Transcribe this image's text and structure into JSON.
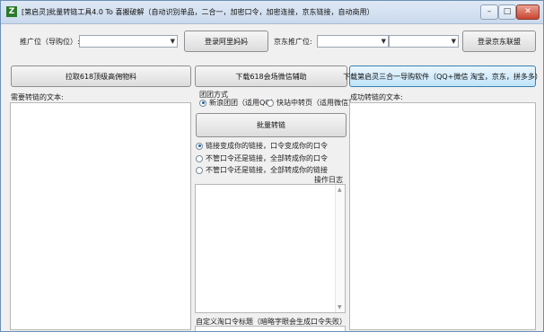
{
  "window": {
    "title": "[第启灵]批量转链工具4.0 To 喜搬破解（自动识别单品，二合一，加密口令，加密连接，京东链接，自动商用）",
    "min_glyph": "–",
    "max_glyph": "□",
    "close_glyph": "✕"
  },
  "top": {
    "promo_label": "推广位（导购位）:",
    "promo_value": "",
    "login_alimama": "登录阿里妈妈",
    "jd_promo_label": "京东推广位:",
    "jd_value1": "",
    "jd_value2": "",
    "login_jd": "登录京东联盟"
  },
  "actions": {
    "pull_button": "拉取618顶级高佣物料",
    "download_assist": "下载618会场微信辅助",
    "download_three": "下载第启灵三合一导购软件（QQ+微信 淘宝，京东，拼多多）"
  },
  "left": {
    "label": "需要转链的文本:"
  },
  "middle": {
    "method_label": "团团方式",
    "radio1": "新浪团团（适用QQ）",
    "radio2": "快站中转页（适用微信）",
    "batch_button": "批量转链",
    "opt1": "链接变成你的链接，口令变成你的口令",
    "opt2": "不管口令还是链接，全部转成你的口令",
    "opt3": "不管口令还是链接，全部转成你的链接",
    "log_label": "操作日志",
    "bottom_label": "自定义淘口令标题（暗略字眼会生成口令失败）"
  },
  "right": {
    "label": "成功转链的文本:"
  },
  "colors": {
    "accent": "#3c7fb1",
    "close": "#c9452f"
  }
}
